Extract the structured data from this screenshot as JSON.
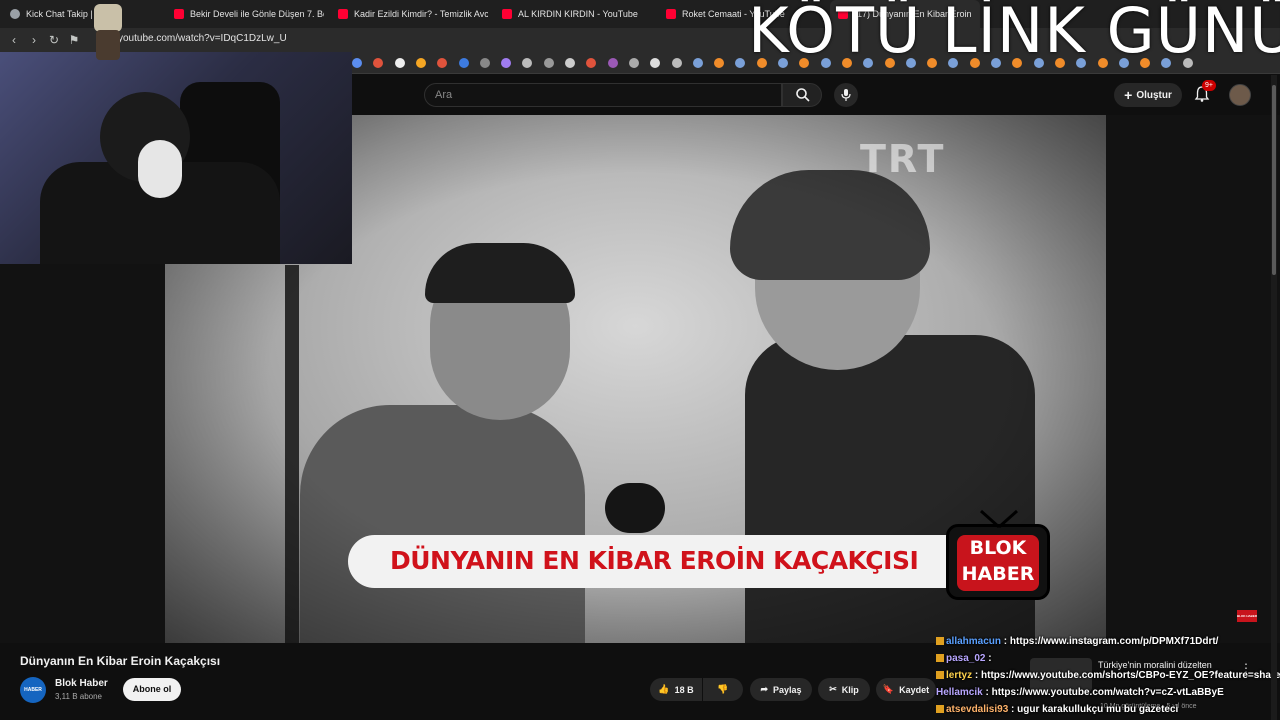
{
  "browser": {
    "tabs": [
      {
        "label": "Kick Chat Takip | Wi",
        "icon": "globe-icon"
      },
      {
        "label": "Bekir Develi ile Gönle Düşen 7. Bölüm",
        "icon": "youtube-icon"
      },
      {
        "label": "Kadir Ezildi Kimdir? - Temizlik Avcıları",
        "icon": "youtube-icon"
      },
      {
        "label": "AL KIRDIN KIRDIN - YouTube",
        "icon": "youtube-icon"
      },
      {
        "label": "Roket Cemaati - YouTube",
        "icon": "youtube-icon"
      },
      {
        "label": "(17) Dünyanın En Kibar Eroin",
        "icon": "youtube-icon"
      }
    ],
    "url": "youtube.com/watch?v=IDqC1DzLw_U"
  },
  "overlay_title": "KÖTÜ LİNK GÜNÜ",
  "youtube": {
    "search_placeholder": "Ara",
    "create_label": "Oluştur",
    "notif_count": "9+"
  },
  "video": {
    "watermark": "TRT",
    "caption": "DÜNYANIN EN KİBAR EROİN KAÇAKÇISI",
    "brand_line1": "BLOK",
    "brand_line2": "HABER",
    "brand_small": "BLOK HABER"
  },
  "info": {
    "title": "Dünyanın En Kibar Eroin Kaçakçısı",
    "channel": "Blok Haber",
    "channel_avatar": "HABER",
    "subscribers": "3,11 B abone",
    "subscribe_label": "Abone ol",
    "likes": "18 B",
    "share_label": "Paylaş",
    "clip_label": "Klip",
    "save_label": "Kaydet"
  },
  "chat": [
    {
      "user": "allahmacun",
      "text": "https://www.instagram.com/p/DPMXf71Ddrt/"
    },
    {
      "user": "pasa_02",
      "text": ""
    },
    {
      "user": "lertyz",
      "text": "https://www.youtube.com/shorts/CBPo-EYZ_OE?feature=share"
    },
    {
      "user": "Hellamcik",
      "text": "https://www.youtube.com/watch?v=cZ-vtLaBByE"
    },
    {
      "user": "atsevdalisi93",
      "text": "ugur karakullukçu mu bu gazeteci"
    }
  ],
  "side": {
    "notif_text": "Türkiye'nin moralini düzelten",
    "notif_meta": "10 Mn görüntüleme · 5 yıl önce"
  },
  "colors": {
    "caption_red": "#d0121b",
    "brand_red": "#c8141c",
    "youtube_bg": "#0f0f0f"
  }
}
